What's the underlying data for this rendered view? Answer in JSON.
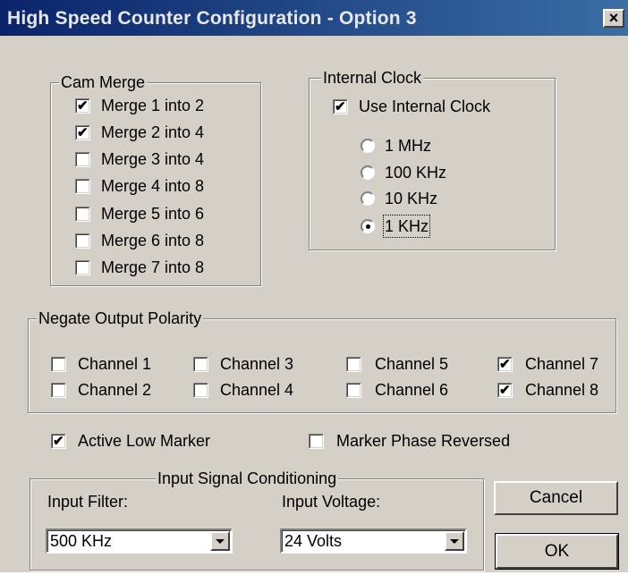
{
  "window": {
    "title": "High Speed Counter Configuration - Option 3",
    "close_glyph": "×"
  },
  "cam_merge": {
    "legend": "Cam Merge",
    "items": [
      {
        "label": "Merge 1 into 2",
        "checked": true
      },
      {
        "label": "Merge 2 into 4",
        "checked": true
      },
      {
        "label": "Merge 3 into 4",
        "checked": false
      },
      {
        "label": "Merge 4 into 8",
        "checked": false
      },
      {
        "label": "Merge 5 into 6",
        "checked": false
      },
      {
        "label": "Merge 6 into 8",
        "checked": false
      },
      {
        "label": "Merge 7 into 8",
        "checked": false
      }
    ]
  },
  "internal_clock": {
    "legend": "Internal Clock",
    "use_internal": {
      "label": "Use Internal Clock",
      "checked": true
    },
    "options": [
      {
        "label": "1 MHz",
        "selected": false
      },
      {
        "label": "100 KHz",
        "selected": false
      },
      {
        "label": "10 KHz",
        "selected": false
      },
      {
        "label": "1 KHz",
        "selected": true
      }
    ]
  },
  "negate_output": {
    "legend": "Negate Output Polarity",
    "channels": [
      {
        "label": "Channel 1",
        "checked": false
      },
      {
        "label": "Channel 2",
        "checked": false
      },
      {
        "label": "Channel 3",
        "checked": false
      },
      {
        "label": "Channel 4",
        "checked": false
      },
      {
        "label": "Channel 5",
        "checked": false
      },
      {
        "label": "Channel 6",
        "checked": false
      },
      {
        "label": "Channel 7",
        "checked": true
      },
      {
        "label": "Channel 8",
        "checked": true
      }
    ]
  },
  "options": {
    "active_low_marker": {
      "label": "Active Low Marker",
      "checked": true
    },
    "marker_phase_reversed": {
      "label": "Marker Phase Reversed",
      "checked": false
    }
  },
  "input_signal": {
    "legend": "Input Signal Conditioning",
    "filter_label": "Input Filter:",
    "filter_value": "500 KHz",
    "voltage_label": "Input Voltage:",
    "voltage_value": "24 Volts"
  },
  "buttons": {
    "cancel": "Cancel",
    "ok": "OK"
  }
}
